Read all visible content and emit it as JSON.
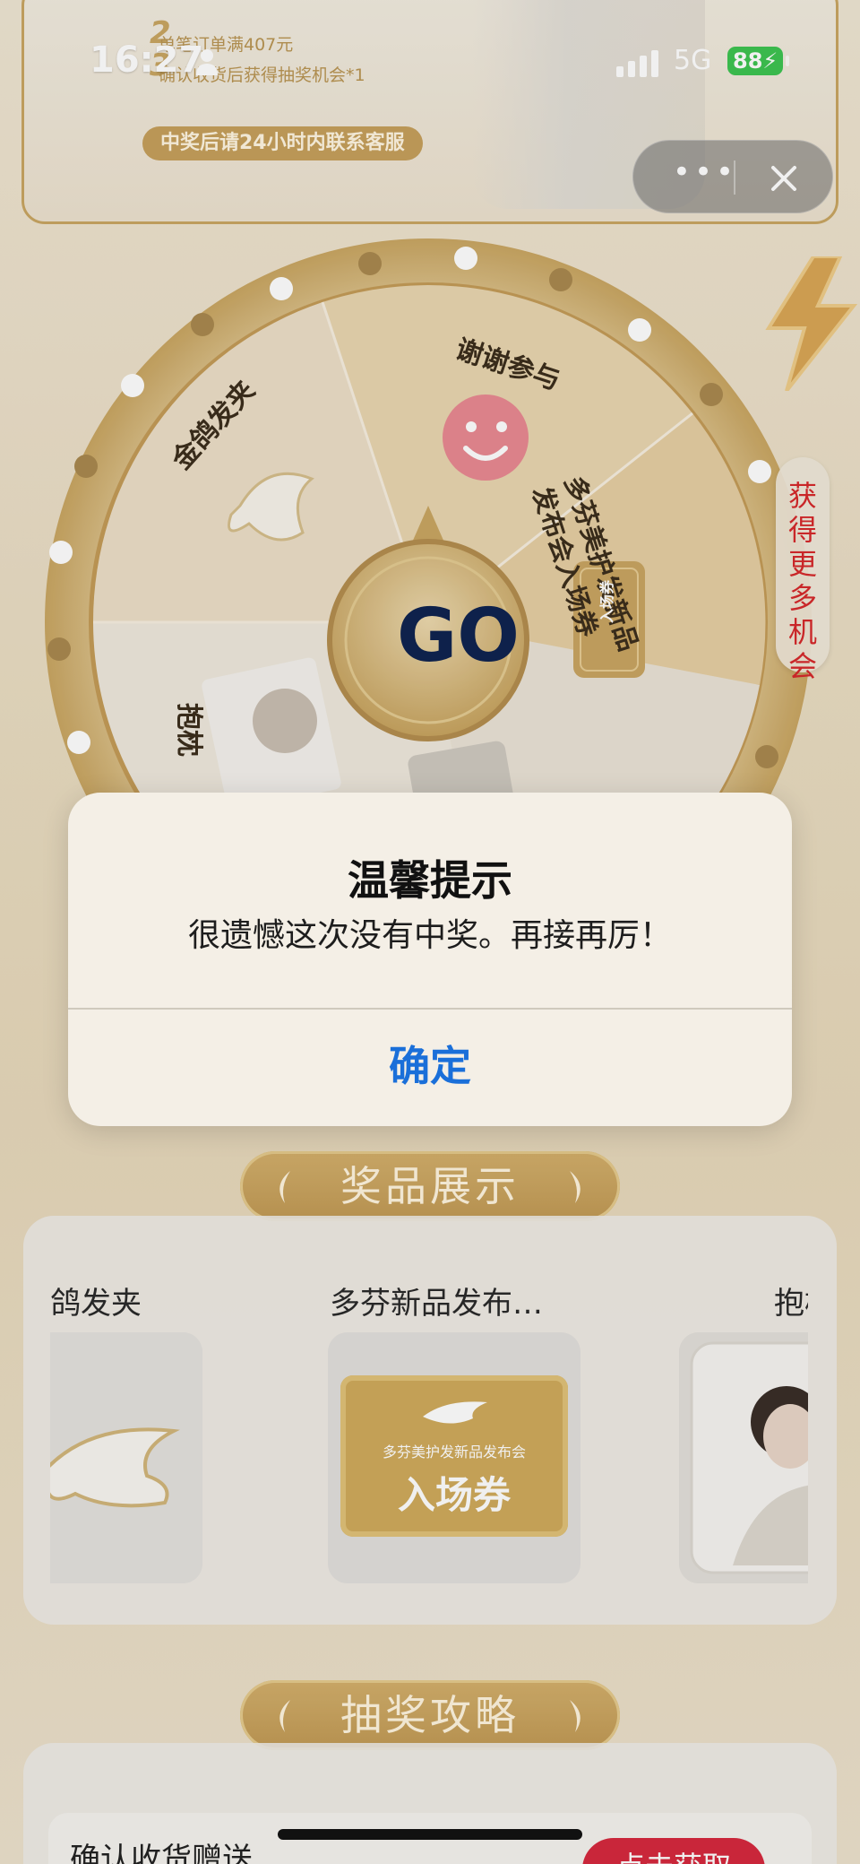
{
  "status_bar": {
    "time": "16:27",
    "network": "5G",
    "battery": "88"
  },
  "promo": {
    "rule_1": "单笔订单满407元",
    "rule_2": "确认收货后获得抽奖机会*1",
    "contact_note": "中奖后请24小时内联系客服"
  },
  "capsule": {
    "more_label": "•••"
  },
  "wheel": {
    "segments": [
      {
        "label": "谢谢参与"
      },
      {
        "label": "多芬美护发新品发布会入场券"
      },
      {
        "label": "金鸽发夹"
      },
      {
        "label": "抱枕"
      }
    ],
    "ticket_text": "入场券",
    "go_label": "GO"
  },
  "more_chances": "获得更多机会",
  "dialog": {
    "title": "温馨提示",
    "message": "很遗憾这次没有中奖。再接再厉！",
    "confirm": "确定"
  },
  "prizes": {
    "section_title": "奖品展示",
    "items": [
      {
        "name": "鸽发夹"
      },
      {
        "name": "多芬新品发布…",
        "ticket_small": "多芬美护发新品发布会",
        "ticket_big": "入场券"
      },
      {
        "name": "抱枕"
      }
    ]
  },
  "strategy": {
    "section_title": "抽奖攻略",
    "task_label": "确认收货赠送",
    "task_button": "点击获取"
  },
  "colors": {
    "gold": "#c6a05c",
    "accent_blue": "#1a6fd9",
    "red": "#d6292b"
  }
}
